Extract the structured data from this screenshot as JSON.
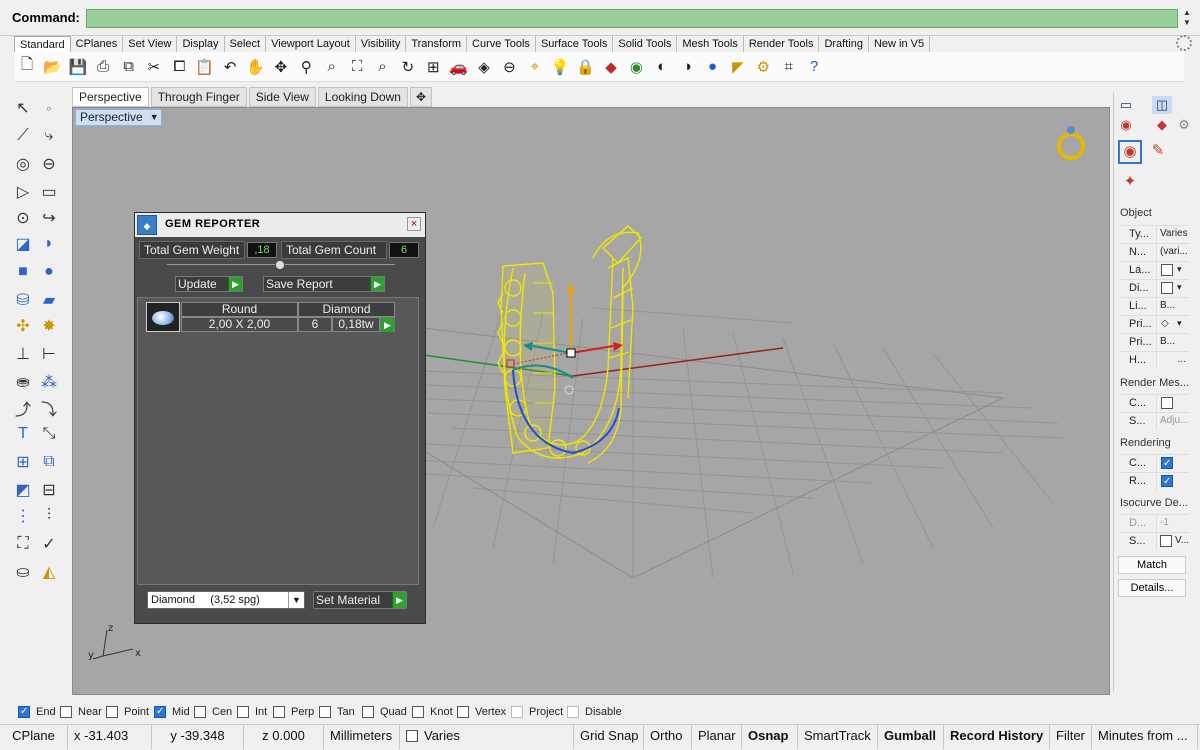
{
  "command": {
    "label": "Command:",
    "value": ""
  },
  "toolbar_tabs": [
    "Standard",
    "CPlanes",
    "Set View",
    "Display",
    "Select",
    "Viewport Layout",
    "Visibility",
    "Transform",
    "Curve Tools",
    "Surface Tools",
    "Solid Tools",
    "Mesh Tools",
    "Render Tools",
    "Drafting",
    "New in V5"
  ],
  "main_toolbar_icons": [
    "new-file-icon",
    "open-folder-icon",
    "save-icon",
    "print-icon",
    "import-icon",
    "cut-icon",
    "copy-icon",
    "paste-icon",
    "undo-icon",
    "pan-hand-icon",
    "move-icon",
    "zoom-icon",
    "zoom-window-icon",
    "zoom-extents-icon",
    "zoom-selected-icon",
    "rotate-view-icon",
    "four-viewports-icon",
    "car-render-icon",
    "display-mode-icon",
    "cplane-icon",
    "cplane-3point-icon",
    "light-bulb-icon",
    "lock-icon",
    "material-icon",
    "color-wheel-icon",
    "shaded-sphere-icon",
    "rendered-sphere-icon",
    "blue-sphere-icon",
    "analysis-icon",
    "gear-settings-icon",
    "dimension-icon",
    "help-icon"
  ],
  "viewport_tabs": [
    "Perspective",
    "Through Finger",
    "Side View",
    "Looking Down"
  ],
  "viewport": {
    "title": "Perspective",
    "axis_x": "x",
    "axis_y": "y",
    "axis_z": "z"
  },
  "gem_reporter": {
    "title": "GEM REPORTER",
    "total_weight_label": "Total Gem Weight",
    "total_weight_value": ",18",
    "total_count_label": "Total Gem Count",
    "total_count_value": "6",
    "update_label": "Update",
    "save_report_label": "Save Report",
    "table_headers": [
      "Round",
      "Diamond"
    ],
    "rows": [
      {
        "size": "2,00 X 2,00",
        "count": "6",
        "weight": "0,18tw"
      }
    ],
    "material_select": "Diamond     (3,52 spg)",
    "set_material_label": "Set Material"
  },
  "right_panel": {
    "object_section": "Object",
    "properties": [
      {
        "key": "Ty...",
        "value": "Varies"
      },
      {
        "key": "N...",
        "value": "(vari..."
      },
      {
        "key": "La...",
        "value": ""
      },
      {
        "key": "Di...",
        "value": ""
      },
      {
        "key": "Li...",
        "value": "B..."
      },
      {
        "key": "Pri...",
        "value": ""
      },
      {
        "key": "Pri...",
        "value": "B..."
      },
      {
        "key": "H...",
        "value": "..."
      }
    ],
    "render_mesh_section": "Render Mes...",
    "render_mesh_rows": [
      {
        "key": "C...",
        "value": ""
      },
      {
        "key": "S...",
        "value": "Adju..."
      }
    ],
    "rendering_section": "Rendering",
    "rendering_rows": [
      {
        "key": "C...",
        "checked": true
      },
      {
        "key": "R...",
        "checked": true
      }
    ],
    "isocurve_section": "Isocurve De...",
    "isocurve_rows": [
      {
        "key": "D...",
        "value": "-1"
      },
      {
        "key": "S...",
        "value": "V..."
      }
    ],
    "match_label": "Match",
    "details_label": "Details..."
  },
  "osnaps": [
    {
      "label": "End",
      "checked": true
    },
    {
      "label": "Near",
      "checked": false
    },
    {
      "label": "Point",
      "checked": false
    },
    {
      "label": "Mid",
      "checked": true
    },
    {
      "label": "Cen",
      "checked": false
    },
    {
      "label": "Int",
      "checked": false
    },
    {
      "label": "Perp",
      "checked": false
    },
    {
      "label": "Tan",
      "checked": false
    },
    {
      "label": "Quad",
      "checked": false
    },
    {
      "label": "Knot",
      "checked": false
    },
    {
      "label": "Vertex",
      "checked": false
    },
    {
      "label": "Project",
      "checked": false
    },
    {
      "label": "Disable",
      "checked": false
    }
  ],
  "status_bar": {
    "cplane": "CPlane",
    "x": "x -31.403",
    "y": "y -39.348",
    "z": "z 0.000",
    "units": "Millimeters",
    "layer": "Varies",
    "toggles": [
      "Grid Snap",
      "Ortho",
      "Planar",
      "Osnap",
      "SmartTrack",
      "Gumball",
      "Record History",
      "Filter",
      "Minutes from ..."
    ]
  }
}
